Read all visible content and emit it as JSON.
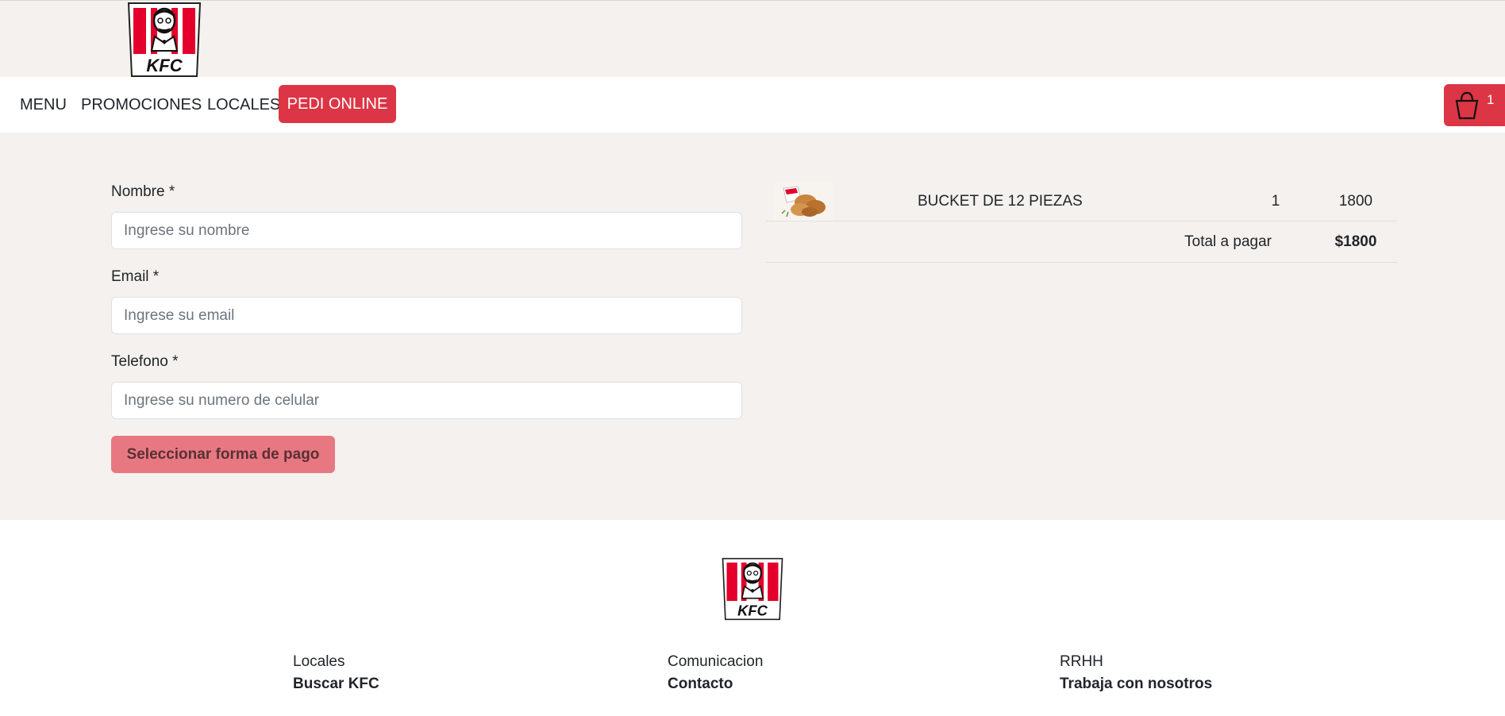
{
  "brand": {
    "logo_text": "KFC",
    "accent_color": "#dc3545",
    "background_color": "#f4f1ee"
  },
  "nav": {
    "items": [
      {
        "label": "MENU"
      },
      {
        "label": "PROMOCIONES"
      },
      {
        "label": "LOCALES"
      }
    ],
    "cta_label": "PEDI ONLINE",
    "cart": {
      "icon": "bucket-icon",
      "count": "1"
    }
  },
  "form": {
    "name": {
      "label": "Nombre *",
      "placeholder": "Ingrese su nombre"
    },
    "email": {
      "label": "Email *",
      "placeholder": "Ingrese su email"
    },
    "phone": {
      "label": "Telefono *",
      "placeholder": "Ingrese su numero de celular"
    },
    "submit_label": "Seleccionar forma de pago"
  },
  "cart": {
    "items": [
      {
        "name": "BUCKET DE 12 PIEZAS",
        "quantity": "1",
        "price": "1800"
      }
    ],
    "total_label": "Total a pagar",
    "total_value": "$1800"
  },
  "footer": {
    "columns": [
      {
        "heading": "Locales",
        "link": "Buscar KFC"
      },
      {
        "heading": "Comunicacion",
        "link": "Contacto"
      },
      {
        "heading": "RRHH",
        "link": "Trabaja con nosotros"
      }
    ]
  }
}
